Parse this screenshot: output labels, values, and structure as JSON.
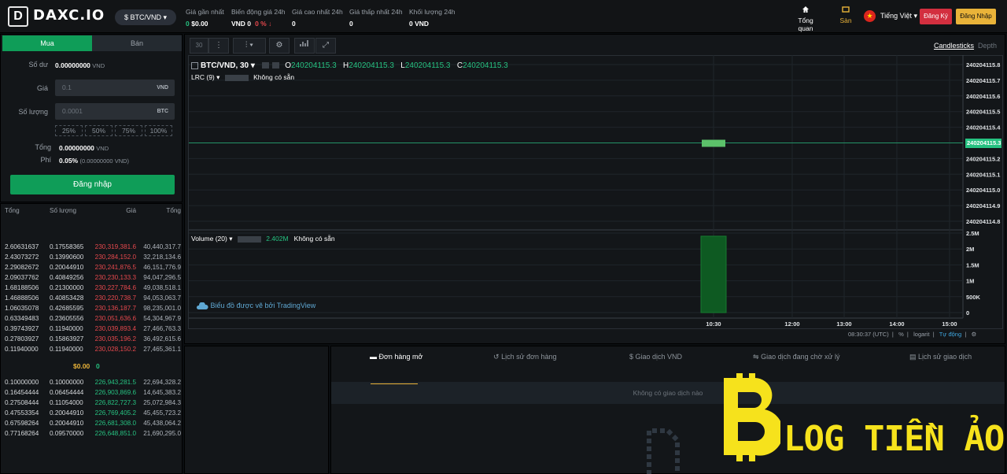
{
  "brand": {
    "logo_letter": "D",
    "name": "DAXC.IO"
  },
  "pair_selector": "$ BTC/VND ▾",
  "stats": [
    {
      "label": "Giá gần nhất",
      "value_parts": [
        "0",
        "$0.00"
      ]
    },
    {
      "label": "Biến động giá 24h",
      "value_parts": [
        "VND 0",
        "0 % ↓"
      ]
    },
    {
      "label": "Giá cao nhất 24h",
      "value_parts": [
        "0"
      ]
    },
    {
      "label": "Giá thấp nhất 24h",
      "value_parts": [
        "0"
      ]
    },
    {
      "label": "Khối lượng 24h",
      "value_parts": [
        "0 VND"
      ]
    }
  ],
  "nav": {
    "overview": "Tổng quan",
    "exchange": "Sàn",
    "language": "Tiếng Việt ▾",
    "register": "Đăng Ký",
    "login": "Đăng Nhập"
  },
  "trade_form": {
    "tab_buy": "Mua",
    "tab_sell": "Bán",
    "balance_label": "Số dư",
    "balance_value": "0.00000000",
    "balance_unit": "VND",
    "price_label": "Giá",
    "price_placeholder": "0.1",
    "price_unit": "VND",
    "qty_label": "Số lượng",
    "qty_placeholder": "0.0001",
    "qty_unit": "BTC",
    "percents": [
      "25%",
      "50%",
      "75%",
      "100%"
    ],
    "total_label": "Tổng",
    "total_value": "0.00000000",
    "total_unit": "VND",
    "fee_label": "Phí",
    "fee_value": "0.05%",
    "fee_detail": "(0.00000000 VND)",
    "submit": "Đăng nhập"
  },
  "orderbook": {
    "headers": [
      "Tổng",
      "Số lượng",
      "Giá",
      "Tổng"
    ],
    "asks": [
      [
        "2.60631637",
        "0.17558365",
        "230,319,381.6",
        "40,440,317.7"
      ],
      [
        "2.43073272",
        "0.13990600",
        "230,284,152.0",
        "32,218,134.6"
      ],
      [
        "2.29082672",
        "0.20044910",
        "230,241,876.5",
        "46,151,776.9"
      ],
      [
        "2.09037762",
        "0.40849256",
        "230,230,133.3",
        "94,047,296.5"
      ],
      [
        "1.68188506",
        "0.21300000",
        "230,227,784.6",
        "49,038,518.1"
      ],
      [
        "1.46888506",
        "0.40853428",
        "230,220,738.7",
        "94,053,063.7"
      ],
      [
        "1.06035078",
        "0.42685595",
        "230,136,187.7",
        "98,235,001.0"
      ],
      [
        "0.63349483",
        "0.23605556",
        "230,051,636.6",
        "54,304,967.9"
      ],
      [
        "0.39743927",
        "0.11940000",
        "230,039,893.4",
        "27,466,763.3"
      ],
      [
        "0.27803927",
        "0.15863927",
        "230,035,196.2",
        "36,492,615.6"
      ],
      [
        "0.11940000",
        "0.11940000",
        "230,028,150.2",
        "27,465,361.1"
      ]
    ],
    "mid_price": "$0.00",
    "mid_change": "0",
    "bids": [
      [
        "0.10000000",
        "0.10000000",
        "226,943,281.5",
        "22,694,328.2"
      ],
      [
        "0.16454444",
        "0.06454444",
        "226,903,869.6",
        "14,645,383.2"
      ],
      [
        "0.27508444",
        "0.11054000",
        "226,822,727.3",
        "25,072,984.3"
      ],
      [
        "0.47553354",
        "0.20044910",
        "226,769,405.2",
        "45,455,723.2"
      ],
      [
        "0.67598264",
        "0.20044910",
        "226,681,308.0",
        "45,438,064.2"
      ],
      [
        "0.77168264",
        "0.09570000",
        "226,648,851.0",
        "21,690,295.0"
      ]
    ]
  },
  "chart_toolbar": {
    "interval": "30",
    "views": [
      "Candlesticks",
      "Depth"
    ]
  },
  "chart": {
    "legend_symbol": "BTC/VND, 30 ▾",
    "ohlc": [
      [
        "O",
        "240204115.3"
      ],
      [
        "H",
        "240204115.3"
      ],
      [
        "L",
        "240204115.3"
      ],
      [
        "C",
        "240204115.3"
      ]
    ],
    "indicator": "LRC (9) ▾",
    "indicator_status": "Không có sẵn",
    "volume_label": "Volume (20) ▾",
    "volume_value": "2.402M",
    "volume_status": "Không có sẵn",
    "y_ticks": [
      "240204115.8",
      "240204115.7",
      "240204115.6",
      "240204115.5",
      "240204115.4",
      "240204115.3",
      "240204115.2",
      "240204115.1",
      "240204115.0",
      "240204114.9",
      "240204114.8"
    ],
    "current_price": "240204115.3",
    "vol_ticks": [
      "2.5M",
      "2M",
      "1.5M",
      "1M",
      "500K",
      "0"
    ],
    "x_ticks": [
      "10:30",
      "12:00",
      "13:00",
      "14:00",
      "15:00"
    ],
    "watermark": "Biểu đồ được vẽ bởi TradingView",
    "footer": {
      "time": "08:30:37 (UTC)",
      "pct": "%",
      "log": "logarit",
      "auto": "Tự động"
    }
  },
  "chart_data": {
    "type": "bar",
    "candles": [
      {
        "time": "10:30",
        "open": 240204115.3,
        "high": 240204115.3,
        "low": 240204115.3,
        "close": 240204115.3,
        "volume": 2402000
      }
    ],
    "ylim": [
      240204114.8,
      240204115.8
    ],
    "volume_ylim": [
      0,
      2500000
    ]
  },
  "orders_tabs": [
    "Đơn hàng mở",
    "Lịch sử đơn hàng",
    "Giao dịch VND",
    "Giao dịch đang chờ xử lý",
    "Lịch sử giao dịch"
  ],
  "orders_empty": "Không có giao dịch nào",
  "blog_watermark": "LOG TIỀN ẢO",
  "colors": {
    "green": "#26c281",
    "red": "#e5484d",
    "accent": "#e9b339",
    "buy": "#0f9d58"
  }
}
